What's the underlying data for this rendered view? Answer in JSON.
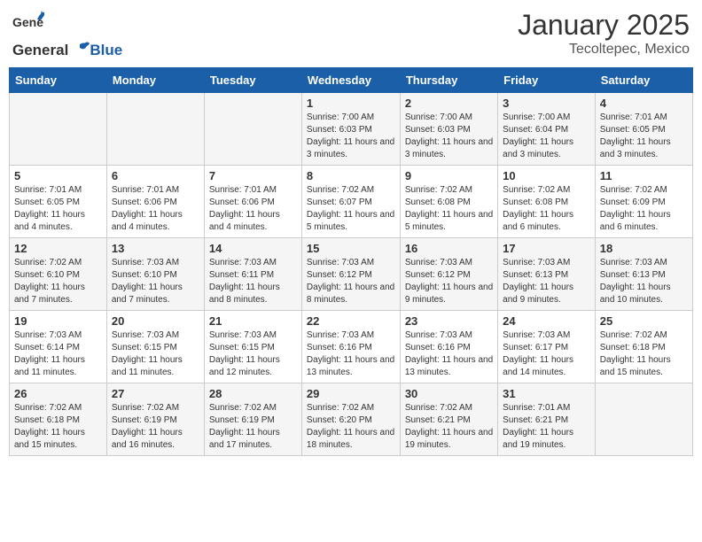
{
  "header": {
    "logo_general": "General",
    "logo_blue": "Blue",
    "month_year": "January 2025",
    "location": "Tecoltepec, Mexico"
  },
  "days_of_week": [
    "Sunday",
    "Monday",
    "Tuesday",
    "Wednesday",
    "Thursday",
    "Friday",
    "Saturday"
  ],
  "weeks": [
    [
      {
        "day": "",
        "info": ""
      },
      {
        "day": "",
        "info": ""
      },
      {
        "day": "",
        "info": ""
      },
      {
        "day": "1",
        "info": "Sunrise: 7:00 AM\nSunset: 6:03 PM\nDaylight: 11 hours\nand 3 minutes."
      },
      {
        "day": "2",
        "info": "Sunrise: 7:00 AM\nSunset: 6:03 PM\nDaylight: 11 hours\nand 3 minutes."
      },
      {
        "day": "3",
        "info": "Sunrise: 7:00 AM\nSunset: 6:04 PM\nDaylight: 11 hours\nand 3 minutes."
      },
      {
        "day": "4",
        "info": "Sunrise: 7:01 AM\nSunset: 6:05 PM\nDaylight: 11 hours\nand 3 minutes."
      }
    ],
    [
      {
        "day": "5",
        "info": "Sunrise: 7:01 AM\nSunset: 6:05 PM\nDaylight: 11 hours\nand 4 minutes."
      },
      {
        "day": "6",
        "info": "Sunrise: 7:01 AM\nSunset: 6:06 PM\nDaylight: 11 hours\nand 4 minutes."
      },
      {
        "day": "7",
        "info": "Sunrise: 7:01 AM\nSunset: 6:06 PM\nDaylight: 11 hours\nand 4 minutes."
      },
      {
        "day": "8",
        "info": "Sunrise: 7:02 AM\nSunset: 6:07 PM\nDaylight: 11 hours\nand 5 minutes."
      },
      {
        "day": "9",
        "info": "Sunrise: 7:02 AM\nSunset: 6:08 PM\nDaylight: 11 hours\nand 5 minutes."
      },
      {
        "day": "10",
        "info": "Sunrise: 7:02 AM\nSunset: 6:08 PM\nDaylight: 11 hours\nand 6 minutes."
      },
      {
        "day": "11",
        "info": "Sunrise: 7:02 AM\nSunset: 6:09 PM\nDaylight: 11 hours\nand 6 minutes."
      }
    ],
    [
      {
        "day": "12",
        "info": "Sunrise: 7:02 AM\nSunset: 6:10 PM\nDaylight: 11 hours\nand 7 minutes."
      },
      {
        "day": "13",
        "info": "Sunrise: 7:03 AM\nSunset: 6:10 PM\nDaylight: 11 hours\nand 7 minutes."
      },
      {
        "day": "14",
        "info": "Sunrise: 7:03 AM\nSunset: 6:11 PM\nDaylight: 11 hours\nand 8 minutes."
      },
      {
        "day": "15",
        "info": "Sunrise: 7:03 AM\nSunset: 6:12 PM\nDaylight: 11 hours\nand 8 minutes."
      },
      {
        "day": "16",
        "info": "Sunrise: 7:03 AM\nSunset: 6:12 PM\nDaylight: 11 hours\nand 9 minutes."
      },
      {
        "day": "17",
        "info": "Sunrise: 7:03 AM\nSunset: 6:13 PM\nDaylight: 11 hours\nand 9 minutes."
      },
      {
        "day": "18",
        "info": "Sunrise: 7:03 AM\nSunset: 6:13 PM\nDaylight: 11 hours\nand 10 minutes."
      }
    ],
    [
      {
        "day": "19",
        "info": "Sunrise: 7:03 AM\nSunset: 6:14 PM\nDaylight: 11 hours\nand 11 minutes."
      },
      {
        "day": "20",
        "info": "Sunrise: 7:03 AM\nSunset: 6:15 PM\nDaylight: 11 hours\nand 11 minutes."
      },
      {
        "day": "21",
        "info": "Sunrise: 7:03 AM\nSunset: 6:15 PM\nDaylight: 11 hours\nand 12 minutes."
      },
      {
        "day": "22",
        "info": "Sunrise: 7:03 AM\nSunset: 6:16 PM\nDaylight: 11 hours\nand 13 minutes."
      },
      {
        "day": "23",
        "info": "Sunrise: 7:03 AM\nSunset: 6:16 PM\nDaylight: 11 hours\nand 13 minutes."
      },
      {
        "day": "24",
        "info": "Sunrise: 7:03 AM\nSunset: 6:17 PM\nDaylight: 11 hours\nand 14 minutes."
      },
      {
        "day": "25",
        "info": "Sunrise: 7:02 AM\nSunset: 6:18 PM\nDaylight: 11 hours\nand 15 minutes."
      }
    ],
    [
      {
        "day": "26",
        "info": "Sunrise: 7:02 AM\nSunset: 6:18 PM\nDaylight: 11 hours\nand 15 minutes."
      },
      {
        "day": "27",
        "info": "Sunrise: 7:02 AM\nSunset: 6:19 PM\nDaylight: 11 hours\nand 16 minutes."
      },
      {
        "day": "28",
        "info": "Sunrise: 7:02 AM\nSunset: 6:19 PM\nDaylight: 11 hours\nand 17 minutes."
      },
      {
        "day": "29",
        "info": "Sunrise: 7:02 AM\nSunset: 6:20 PM\nDaylight: 11 hours\nand 18 minutes."
      },
      {
        "day": "30",
        "info": "Sunrise: 7:02 AM\nSunset: 6:21 PM\nDaylight: 11 hours\nand 19 minutes."
      },
      {
        "day": "31",
        "info": "Sunrise: 7:01 AM\nSunset: 6:21 PM\nDaylight: 11 hours\nand 19 minutes."
      },
      {
        "day": "",
        "info": ""
      }
    ]
  ]
}
